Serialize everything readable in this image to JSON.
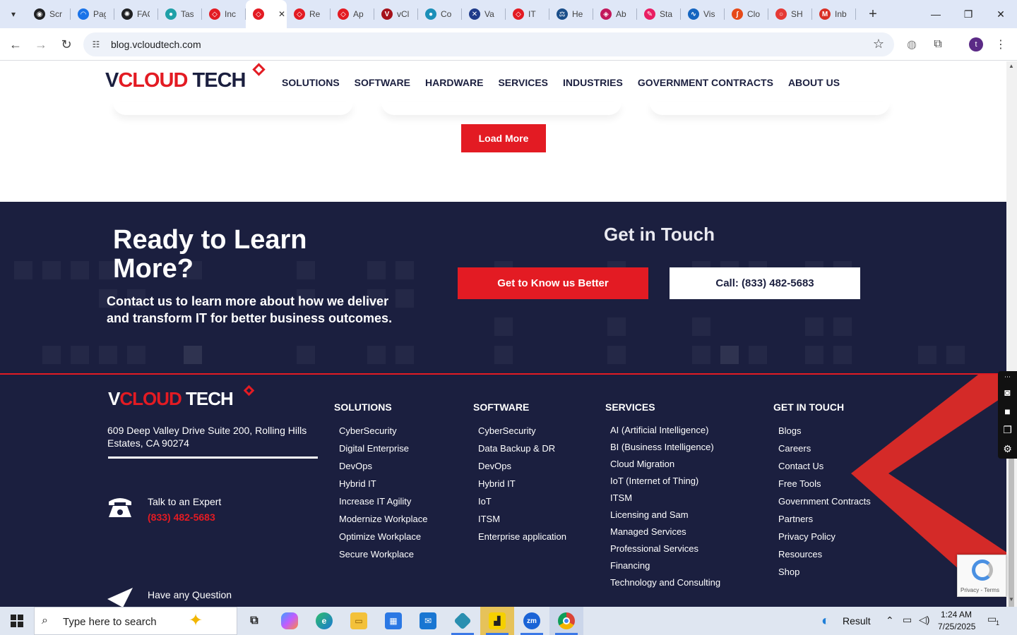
{
  "browser": {
    "tabs": [
      {
        "label": "Scr",
        "color": "#202124",
        "glyph": "◉"
      },
      {
        "label": "Pag",
        "color": "#1a73e8",
        "glyph": "◠"
      },
      {
        "label": "FAQ",
        "color": "#202124",
        "glyph": "✺"
      },
      {
        "label": "Tas",
        "color": "#1fa0a8",
        "glyph": "●"
      },
      {
        "label": "Inc",
        "color": "#e31b23",
        "glyph": "◇"
      },
      {
        "label": "",
        "color": "#e31b23",
        "glyph": "◇",
        "active": true
      },
      {
        "label": "Re",
        "color": "#e31b23",
        "glyph": "◇"
      },
      {
        "label": "Ap",
        "color": "#e31b23",
        "glyph": "◇"
      },
      {
        "label": "vCl",
        "color": "#a5121b",
        "glyph": "V"
      },
      {
        "label": "Co",
        "color": "#1b8fb8",
        "glyph": "●"
      },
      {
        "label": "Va",
        "color": "#1f3b8a",
        "glyph": "✕"
      },
      {
        "label": "IT",
        "color": "#e31b23",
        "glyph": "◇"
      },
      {
        "label": "He",
        "color": "#1a4e8a",
        "glyph": "⚖"
      },
      {
        "label": "Ab",
        "color": "#c2185b",
        "glyph": "◈"
      },
      {
        "label": "Sta",
        "color": "#e91e63",
        "glyph": "✎"
      },
      {
        "label": "Vis",
        "color": "#1565c0",
        "glyph": "∿"
      },
      {
        "label": "Clo",
        "color": "#e64a19",
        "glyph": "∫"
      },
      {
        "label": "SH",
        "color": "#e53935",
        "glyph": "○"
      },
      {
        "label": "Inb",
        "color": "#d93025",
        "glyph": "M"
      }
    ],
    "active_tab_close": "✕",
    "new_tab": "+",
    "url": "blog.vcloudtech.com",
    "profile_initial": "t"
  },
  "site": {
    "logo": {
      "v": "V",
      "cloud": "CLOUD",
      "tech": " TECH"
    },
    "nav": [
      "SOLUTIONS",
      "SOFTWARE",
      "HARDWARE",
      "SERVICES",
      "INDUSTRIES",
      "GOVERNMENT CONTRACTS",
      "ABOUT US"
    ],
    "load_more": "Load More",
    "cta": {
      "title": "Ready to Learn More?",
      "subtitle": "Contact us to learn more about how we deliver and transform IT for better business outcomes.",
      "get_in_touch": "Get in Touch",
      "know_us_button": "Get to Know us Better",
      "call_button": "Call: (833) 482-5683"
    },
    "footer": {
      "address": "609 Deep Valley Drive Suite 200, Rolling Hills Estates, CA 90274",
      "talk_label": "Talk to an Expert",
      "talk_phone": "(833) 482-5683",
      "question_label": "Have any Question",
      "columns": {
        "solutions": {
          "title": "SOLUTIONS",
          "items": [
            "CyberSecurity",
            "Digital Enterprise",
            "DevOps",
            "Hybrid IT",
            "Increase IT Agility",
            "Modernize Workplace",
            "Optimize Workplace",
            "Secure Workplace"
          ]
        },
        "software": {
          "title": "SOFTWARE",
          "items": [
            "CyberSecurity",
            "Data Backup & DR",
            "DevOps",
            "Hybrid IT",
            "IoT",
            "ITSM",
            "Enterprise application"
          ]
        },
        "services": {
          "title": "SERVICES",
          "items": [
            "AI (Artificial Intelligence)",
            "BI (Business Intelligence)",
            "Cloud Migration",
            "IoT (Internet of Thing)",
            "ITSM",
            "Licensing and Sam",
            "Managed Services",
            "Professional Services",
            "Financing",
            "Technology and Consulting"
          ]
        },
        "get_in_touch": {
          "title": "GET IN TOUCH",
          "items": [
            "Blogs",
            "Careers",
            "Contact Us",
            "Free Tools",
            "Government Contracts",
            "Partners",
            "Privacy Policy",
            "Resources",
            "Shop"
          ]
        }
      }
    },
    "recaptcha_text": "Privacy - Terms"
  },
  "colors": {
    "brand_navy": "#1b1f3f",
    "brand_red": "#e31b23"
  },
  "taskbar": {
    "search_placeholder": "Type here to search",
    "weather": "Result",
    "time": "1:24 AM",
    "date": "7/25/2025",
    "notifications": "1"
  }
}
